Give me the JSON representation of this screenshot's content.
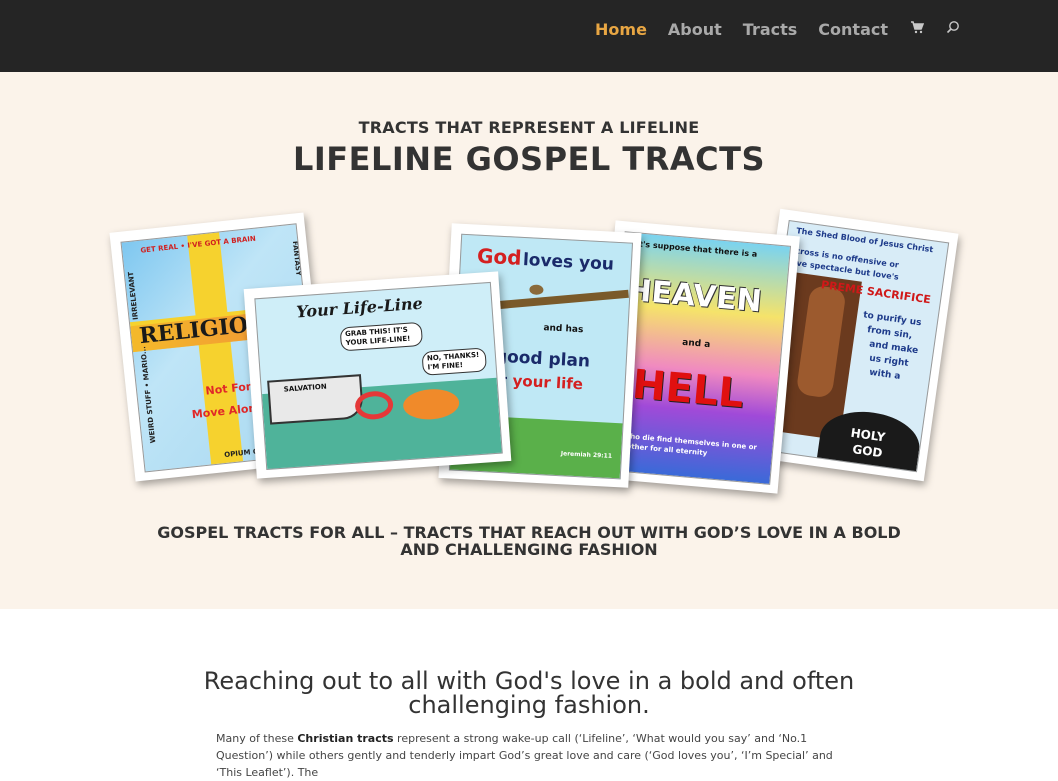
{
  "nav": {
    "items": [
      {
        "label": "Home",
        "active": true
      },
      {
        "label": "About"
      },
      {
        "label": "Tracts"
      },
      {
        "label": "Contact"
      }
    ],
    "cart_icon": "cart-icon",
    "search_icon": "search-icon"
  },
  "hero": {
    "kicker": "TRACTS THAT REPRESENT A LIFELINE",
    "title": "LIFELINE GOSPEL TRACTS",
    "subhead": "GOSPEL TRACTS FOR ALL – TRACTS THAT REACH OUT WITH GOD’S LOVE IN A BOLD AND CHALLENGING FASHION"
  },
  "tracts": {
    "religion": {
      "word": "RELIGION",
      "line1": "Not For Me",
      "line2": "Move Along P",
      "border_top": "GET REAL • I'VE GOT A BRAIN",
      "border_right": "FANTASY",
      "border_left": "IRRELEVANT",
      "border_bottom": "OPIUM OF THE PEOPLE",
      "border_left2": "WEIRD STUFF • MARIO..."
    },
    "lifeline": {
      "title": "Your Life-Line",
      "bubble1": "GRAB THIS! IT'S YOUR LIFE-LINE!",
      "bubble2": "NO, THANKS! I'M FINE!",
      "boat": "SALVATION"
    },
    "godloves": {
      "l1a": "God",
      "l1b": "loves you",
      "l2": "and has",
      "l3": "A good plan",
      "l4a": "for",
      "l4b": "your life",
      "verse": "Jeremiah 29:11"
    },
    "heaven": {
      "top": "Let's suppose that there is a",
      "heaven": "HEAVEN",
      "mid": "and a",
      "hell": "HELL",
      "bottom": "all who die find themselves in one or the other for all eternity"
    },
    "shedblood": {
      "t1": "The Shed Blood of Jesus Christ",
      "t2": "cross is no offensive or",
      "t3": "ive spectacle but love's",
      "t4": "PREME SACRIFICE",
      "t5": "to purify us",
      "t6": "from sin,",
      "t7": "and make",
      "t8": "us right",
      "t9": "with a",
      "t10": "HOLY",
      "t11": "GOD"
    }
  },
  "section": {
    "heading": "Reaching out to all with God's love in a bold and often challenging fashion.",
    "para_pre": "Many of these ",
    "para_bold": "Christian tracts",
    "para_post": " represent a strong wake-up call (‘Lifeline’, ‘What would you say’ and ‘No.1 Question’) while others gently and tenderly impart God’s great love and care (‘God loves you’, ‘I’m Special’ and ‘This Leaflet’). The"
  },
  "colors": {
    "nav_bg": "#252525",
    "nav_active": "#e8a643",
    "nav_text": "#a9a9a9",
    "hero_bg": "#fbf3ea"
  }
}
